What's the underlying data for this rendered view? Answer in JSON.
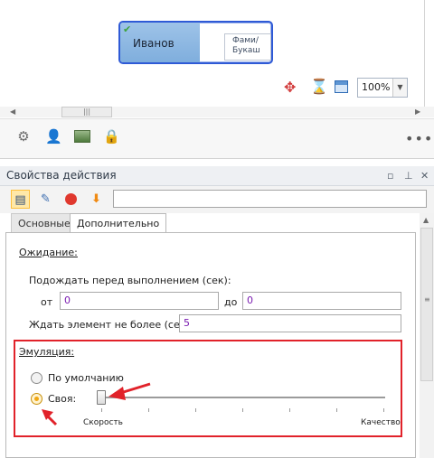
{
  "canvas": {
    "node": {
      "name": "Иванов",
      "card_line1": "Фами/",
      "card_line2": "Букаш"
    },
    "zoom_value": "100%"
  },
  "properties": {
    "title": "Свойства действия",
    "toolbar_input_value": "",
    "tabs": [
      {
        "label": "Основные",
        "active": false
      },
      {
        "label": "Дополнительно",
        "active": true
      }
    ],
    "waiting": {
      "title": "Ожидание:",
      "wait_before_label": "Подождать перед выполнением (сек):",
      "from_label": "от",
      "from_value": "0",
      "to_label": "до",
      "to_value": "0",
      "max_wait_label": "Ждать элемент не более (сек):",
      "max_wait_value": "5"
    },
    "emulation": {
      "title": "Эмуляция:",
      "option_default": "По умолчанию",
      "option_custom": "Своя:",
      "selected": "custom",
      "slider_value": 0,
      "min_label": "Скорость",
      "max_label": "Качество"
    }
  },
  "colors": {
    "highlight": "#e1222a",
    "accent": "#2f5ad6",
    "radio_selected": "#f0a714"
  },
  "icons": [
    "check-icon",
    "move-icon",
    "hourglass-icon",
    "window-icon",
    "chevron-down-icon",
    "gear-icon",
    "user-icon",
    "image-icon",
    "lock-icon",
    "more-icon",
    "pin-icon",
    "close-icon",
    "grid-icon",
    "edit-icon",
    "stop-icon",
    "arrow-down-icon"
  ]
}
